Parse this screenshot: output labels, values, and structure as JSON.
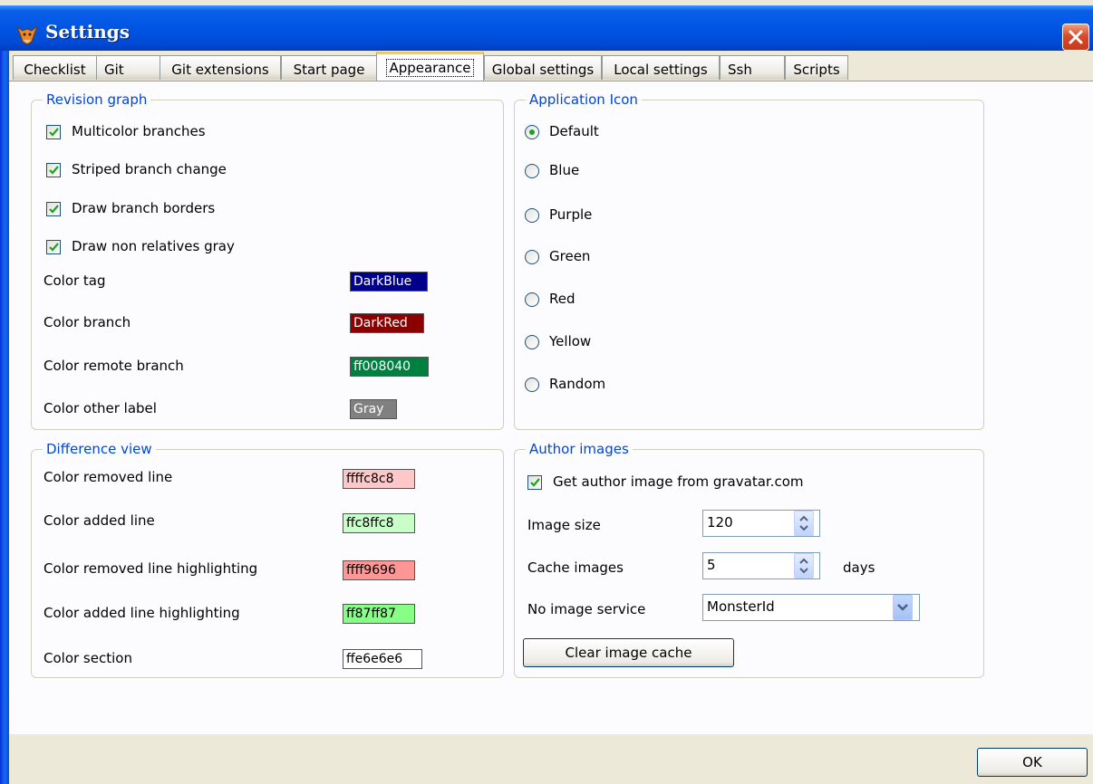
{
  "window": {
    "title": "Settings"
  },
  "tabs": [
    {
      "label": "Checklist"
    },
    {
      "label": "Git"
    },
    {
      "label": "Git extensions"
    },
    {
      "label": "Start page"
    },
    {
      "label": "Appearance",
      "active": true
    },
    {
      "label": "Global settings"
    },
    {
      "label": "Local settings"
    },
    {
      "label": "Ssh"
    },
    {
      "label": "Scripts"
    }
  ],
  "revision_graph": {
    "title": "Revision graph",
    "multicolor_branches": {
      "label": "Multicolor branches",
      "checked": true
    },
    "striped_branch_change": {
      "label": "Striped branch change",
      "checked": true
    },
    "draw_branch_borders": {
      "label": "Draw branch borders",
      "checked": true
    },
    "draw_non_relatives_gray": {
      "label": "Draw non relatives gray",
      "checked": true
    },
    "color_tag": {
      "label": "Color tag",
      "value": "DarkBlue",
      "color": "#00008b"
    },
    "color_branch": {
      "label": "Color branch",
      "value": "DarkRed",
      "color": "#8b0000"
    },
    "color_remote_branch": {
      "label": "Color remote branch",
      "value": "ff008040",
      "color": "#008040"
    },
    "color_other_label": {
      "label": "Color other label",
      "value": "Gray",
      "color": "#808080"
    }
  },
  "application_icon": {
    "title": "Application Icon",
    "options": [
      "Default",
      "Blue",
      "Purple",
      "Green",
      "Red",
      "Yellow",
      "Random"
    ],
    "selected": "Default"
  },
  "difference_view": {
    "title": "Difference view",
    "color_removed_line": {
      "label": "Color removed line",
      "value": "ffffc8c8",
      "color": "#ffc8c8"
    },
    "color_added_line": {
      "label": "Color added line",
      "value": "ffc8ffc8",
      "color": "#c8ffc8"
    },
    "color_removed_line_highlighting": {
      "label": "Color removed line highlighting",
      "value": "ffff9696",
      "color": "#ff9696"
    },
    "color_added_line_highlighting": {
      "label": "Color added line highlighting",
      "value": "ff87ff87",
      "color": "#87ff87"
    },
    "color_section": {
      "label": "Color section",
      "value": "ffe6e6e6",
      "color": "#e6e6e6"
    }
  },
  "author_images": {
    "title": "Author images",
    "get_from_gravatar": {
      "label": "Get author image from gravatar.com",
      "checked": true
    },
    "image_size": {
      "label": "Image size",
      "value": "120"
    },
    "cache_images": {
      "label": "Cache images",
      "value": "5",
      "unit": "days"
    },
    "no_image_service": {
      "label": "No image service",
      "value": "MonsterId"
    },
    "clear_cache_button": "Clear image cache"
  },
  "footer": {
    "ok_button": "OK"
  }
}
